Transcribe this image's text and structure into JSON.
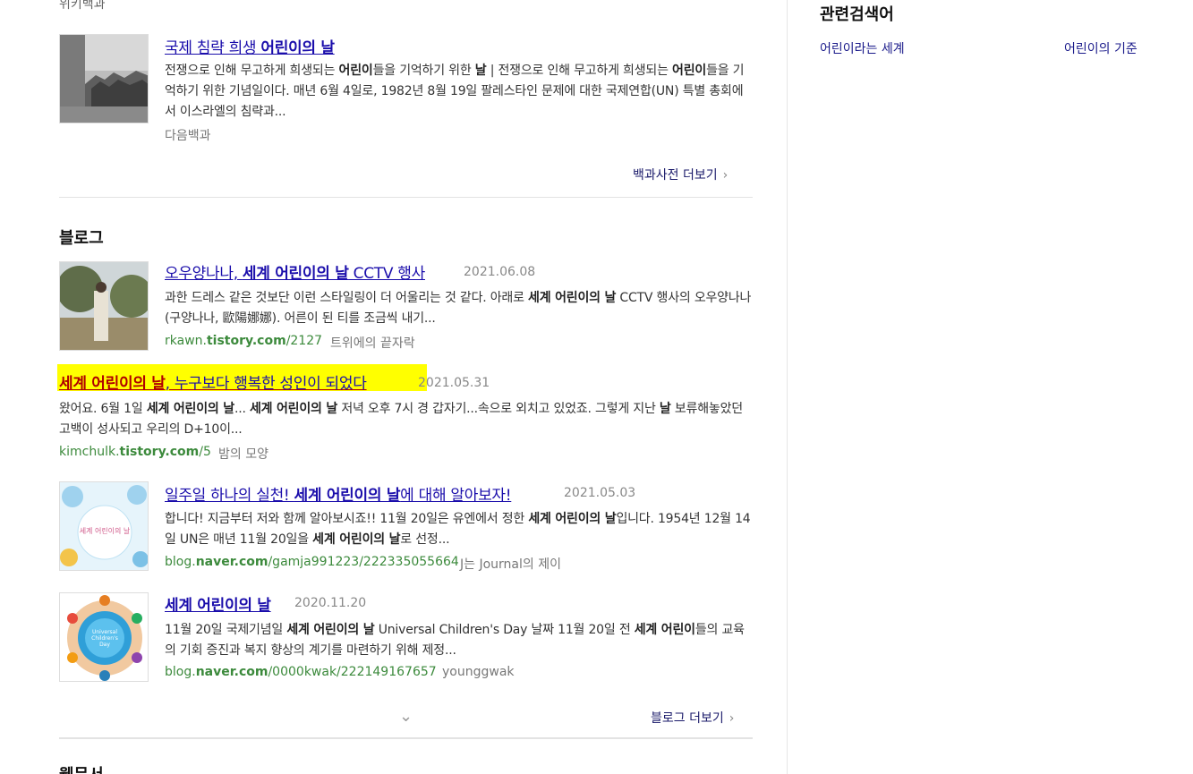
{
  "top": {
    "source": "위키백과"
  },
  "dictionary": {
    "item": {
      "title_plain": "국제 침략 희생 ",
      "title_bold": "어린이의 날",
      "desc1_plain_a": "전쟁으로 인해 무고하게 희생되는 ",
      "desc1_bold_a": "어린이",
      "desc1_plain_b": "들을 기억하기 위한 ",
      "desc1_bold_b": "날",
      "desc1_plain_c": " | 전쟁으로 인해 무고하게 희생되는 ",
      "desc1_bold_c": "어린이",
      "desc1_plain_d": "들을 기억하기 위한 기념일이다. 매년 6월 4일로, 1982년 8월 19일 팔레스타인 문제에 대한 국제연합(UN) 특별 총회에서 이스라엘의 침략과...",
      "source": "다음백과"
    },
    "more_label": "백과사전 더보기",
    "chevron": "›"
  },
  "blog": {
    "section_title": "블로그",
    "items": [
      {
        "title_plain": "오우양나나, ",
        "title_bold": "세계 어린이의 날",
        "title_rest": " CCTV 행사",
        "date": "2021.06.08",
        "desc_a": "과한 드레스 같은 것보단 이런 스타일링이 더 어울리는 것 같다. 아래로 ",
        "desc_bold": "세계 어린이의 날",
        "desc_b": " CCTV 행사의 오우양나나(구양나나, 歐陽娜娜). 어른이 된 티를 조금씩 내기...",
        "url_a": "rkawn.",
        "url_bold": "tistory.com",
        "url_b": "/2127",
        "blog_name": "트위에의 끝자락"
      },
      {
        "title_bold": "세계 어린이의 날",
        "title_rest": ", 누구보다 행복한 성인이 되었다",
        "date": "2021.05.31",
        "desc_a": "왔어요. 6월 1일 ",
        "desc_bold": "세계 어린이의 날",
        "desc_b": "... ",
        "desc_bold2": "세계 어린이의 날",
        "desc_c": " 저녁 오후 7시 경 갑자기...속으로 외치고 있었죠. 그렇게 지난 ",
        "desc_bold3": "날",
        "desc_d": " 보류해놓았던 고백이 성사되고 우리의 D+10이...",
        "url_a": "kimchulk.",
        "url_bold": "tistory.com",
        "url_b": "/5",
        "blog_name": "밤의 모양"
      },
      {
        "title_plain": "일주일 하나의 실천! ",
        "title_bold": "세계 어린이의 날",
        "title_rest": "에 대해 알아보자!",
        "date": "2021.05.03",
        "desc_a": "합니다!  지금부터 저와 함께 알아보시죠!!  11월 20일은 유엔에서 정한 ",
        "desc_bold": "세계 어린이의 날",
        "desc_b": "입니다. 1954년 12월 14일 UN은 매년 11월 20일을 ",
        "desc_bold2": "세계 어린이의 날",
        "desc_c": "로 선정...",
        "url_a": "blog.",
        "url_bold": "naver.com",
        "url_b": "/gamja991223/222335055664",
        "blog_name": "J는 Journal의 제이",
        "thumb_text": "세계 어린이의 날"
      },
      {
        "title_bold": "세계 어린이의 날",
        "date": "2020.11.20",
        "desc_a": "11월 20일 국제기념일  ",
        "desc_bold": "세계 어린이의 날",
        "desc_b": " Universal Children's Day  날짜 11월 20일  전 ",
        "desc_bold2": "세계 어린이",
        "desc_c": "들의 교육의 기회 증진과 복지 향상의 계기를 마련하기 위해 제정...",
        "url_a": "blog.",
        "url_bold": "naver.com",
        "url_b": "/0000kwak/222149167657",
        "blog_name": "younggwak",
        "thumb_text": "Universal Children's Day"
      }
    ],
    "more_label": "블로그 더보기",
    "chevron": "›",
    "expand_icon": "⌄"
  },
  "next_section": {
    "title_partial": "웹문서"
  },
  "sidebar": {
    "title": "관련검색어",
    "links": [
      "어린이라는 세계",
      "어린이의 기준"
    ]
  },
  "colors": {
    "link": "#1a0dab",
    "url": "#3c8a3c",
    "highlight": "#ffff00"
  }
}
